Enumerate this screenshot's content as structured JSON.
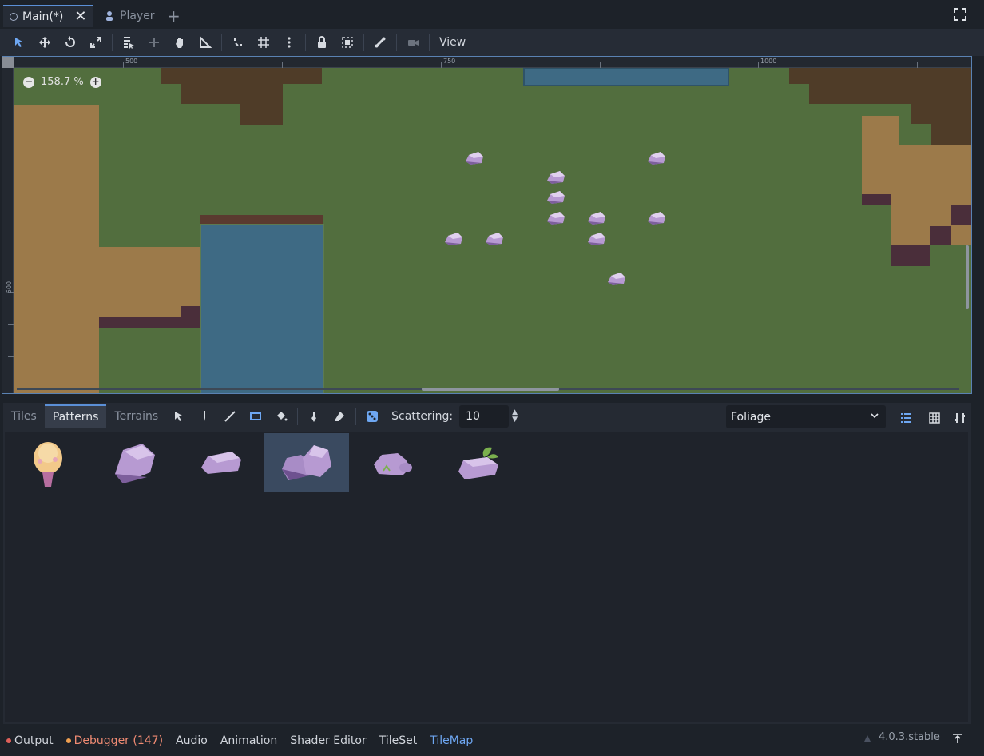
{
  "scene_tabs": [
    {
      "label": "Main(*)",
      "active": true
    },
    {
      "label": "Player",
      "active": false
    }
  ],
  "toolbar": {
    "view_label": "View",
    "tools": [
      "select-mode-icon",
      "move-mode-icon",
      "rotate-mode-icon",
      "scale-mode-icon",
      "list-select-icon",
      "pivot-icon",
      "pan-icon",
      "ruler-icon",
      "smart-snap-icon",
      "grid-snap-icon",
      "more-options-icon",
      "lock-icon",
      "group-icon",
      "bone-icon",
      "camera-override-icon"
    ]
  },
  "viewport": {
    "zoom_label": "158.7 %",
    "ruler_h_labels": [
      "500",
      "750",
      "1000"
    ],
    "ruler_v_labels": [
      "500"
    ]
  },
  "tilemap_panel": {
    "tabs": [
      {
        "label": "Tiles",
        "active": false
      },
      {
        "label": "Patterns",
        "active": true
      },
      {
        "label": "Terrains",
        "active": false
      }
    ],
    "scattering_label": "Scattering:",
    "scattering_value": "10",
    "layer_select": "Foliage",
    "patterns": [
      {
        "name": "tree-pattern",
        "selected": false
      },
      {
        "name": "big-rock-pattern",
        "selected": false
      },
      {
        "name": "flat-rock-pattern",
        "selected": false
      },
      {
        "name": "rock-cluster-pattern",
        "selected": true
      },
      {
        "name": "mossy-rock-pattern",
        "selected": false
      },
      {
        "name": "leafy-rock-pattern",
        "selected": false
      }
    ]
  },
  "status_bar": {
    "items": [
      {
        "label": "Output",
        "dot_color": "#e0605a"
      },
      {
        "label": "Debugger (147)",
        "dot_color": "#f0a050"
      },
      {
        "label": "Audio"
      },
      {
        "label": "Animation"
      },
      {
        "label": "Shader Editor"
      },
      {
        "label": "TileSet"
      },
      {
        "label": "TileMap"
      }
    ],
    "version": "4.0.3.stable"
  },
  "colors": {
    "accent": "#6ea7f2",
    "grass": "#526e3e",
    "dirt": "#9c7a4a",
    "water": "#3e6a84",
    "rock": "#b79ad2"
  }
}
